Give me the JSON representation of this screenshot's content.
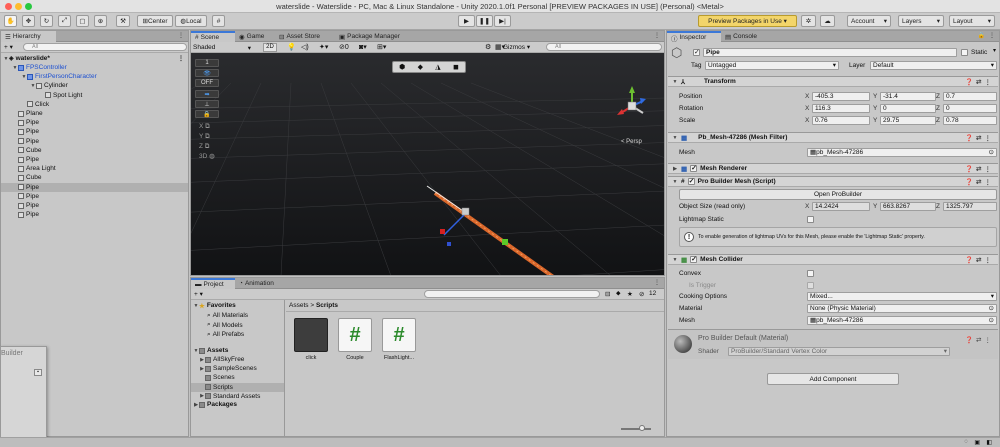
{
  "window": {
    "title": "waterslide - Waterslide - PC, Mac & Linux Standalone - Unity 2020.1.0f1 Personal [PREVIEW PACKAGES IN USE] (Personal) <Metal>"
  },
  "toolbar": {
    "center": "Center",
    "local": "Local",
    "preview_packages": "Preview Packages in Use ▾",
    "account": "Account",
    "layers": "Layers",
    "layout": "Layout"
  },
  "hierarchy": {
    "tab": "Hierarchy",
    "add": "+ ▾",
    "search_placeholder": "All",
    "root": "waterslide*",
    "items": [
      {
        "label": "FPSController",
        "depth": 1,
        "color": "#1b4fd1",
        "expand": "▼"
      },
      {
        "label": "FirstPersonCharacter",
        "depth": 2,
        "color": "#1b4fd1",
        "expand": "▼"
      },
      {
        "label": "Cylinder",
        "depth": 3,
        "color": "#111",
        "expand": "▼"
      },
      {
        "label": "Spot Light",
        "depth": 4,
        "color": "#111",
        "expand": ""
      },
      {
        "label": "Click",
        "depth": 2,
        "color": "#111",
        "expand": ""
      },
      {
        "label": "Plane",
        "depth": 1,
        "color": "#111",
        "expand": ""
      },
      {
        "label": "Pipe",
        "depth": 1,
        "color": "#111",
        "expand": ""
      },
      {
        "label": "Pipe",
        "depth": 1,
        "color": "#111",
        "expand": ""
      },
      {
        "label": "Pipe",
        "depth": 1,
        "color": "#111",
        "expand": ""
      },
      {
        "label": "Cube",
        "depth": 1,
        "color": "#111",
        "expand": ""
      },
      {
        "label": "Pipe",
        "depth": 1,
        "color": "#111",
        "expand": ""
      },
      {
        "label": "Area Light",
        "depth": 1,
        "color": "#111",
        "expand": ""
      },
      {
        "label": "Cube",
        "depth": 1,
        "color": "#111",
        "expand": ""
      },
      {
        "label": "Pipe",
        "depth": 1,
        "color": "#111",
        "expand": ""
      },
      {
        "label": "Pipe",
        "depth": 1,
        "color": "#111",
        "expand": ""
      },
      {
        "label": "Pipe",
        "depth": 1,
        "color": "#111",
        "expand": ""
      },
      {
        "label": "Pipe",
        "depth": 1,
        "color": "#111",
        "expand": ""
      }
    ],
    "selected_index": 13
  },
  "floating_window": {
    "title": "Builder"
  },
  "scene": {
    "tabs": [
      "Scene",
      "Game",
      "Asset Store",
      "Package Manager"
    ],
    "shading": "Shaded",
    "mode_2d": "2D",
    "gizmos": "Gizmos ▾",
    "search_placeholder": "All",
    "persp": "< Persp",
    "axes": [
      "X",
      "Y",
      "Z",
      "3D"
    ],
    "side_labels": [
      "1",
      "OFF"
    ]
  },
  "project": {
    "tabs": [
      "Project",
      "Animation"
    ],
    "favorites_label": "Favorites",
    "favorites": [
      "All Materials",
      "All Models",
      "All Prefabs"
    ],
    "assets_label": "Assets",
    "folders": [
      "AllSkyFree",
      "SampleScenes",
      "Scenes",
      "Scripts",
      "Standard Assets"
    ],
    "selected_folder": "Scripts",
    "packages_label": "Packages",
    "breadcrumb": [
      "Assets",
      "Scripts"
    ],
    "files": [
      {
        "name": "click",
        "type": "dark"
      },
      {
        "name": "Couple",
        "type": "script"
      },
      {
        "name": "FlashLight...",
        "type": "script"
      }
    ],
    "hidden_count": "12"
  },
  "inspector": {
    "tabs": [
      "Inspector",
      "Console"
    ],
    "object_name": "Pipe",
    "static_label": "Static",
    "tag_label": "Tag",
    "tag_value": "Untagged",
    "layer_label": "Layer",
    "layer_value": "Default",
    "transform": {
      "header": "Transform",
      "position_label": "Position",
      "position": {
        "x": "-405.3",
        "y": "-31.4",
        "z": "0.7"
      },
      "rotation_label": "Rotation",
      "rotation": {
        "x": "116.3",
        "y": "0",
        "z": "0"
      },
      "scale_label": "Scale",
      "scale": {
        "x": "0.76",
        "y": "29.75",
        "z": "0.78"
      }
    },
    "mesh_filter": {
      "header": "Pb_Mesh-47286 (Mesh Filter)",
      "mesh_label": "Mesh",
      "mesh_value": "pb_Mesh-47286"
    },
    "mesh_renderer": {
      "header": "Mesh Renderer"
    },
    "probuilder": {
      "header": "Pro Builder Mesh (Script)",
      "open_button": "Open ProBuilder",
      "size_label": "Object Size (read only)",
      "size": {
        "x": "14.2424",
        "y": "663.8267",
        "z": "1325.797"
      },
      "lightmap_label": "Lightmap Static",
      "info": "To enable generation of lightmap UVs for this Mesh, please enable the 'Lightmap Static' property."
    },
    "mesh_collider": {
      "header": "Mesh Collider",
      "convex_label": "Convex",
      "trigger_label": "Is Trigger",
      "cooking_label": "Cooking Options",
      "cooking_value": "Mixed...",
      "material_label": "Material",
      "material_value": "None (Physic Material)",
      "mesh_label": "Mesh",
      "mesh_value": "pb_Mesh-47286"
    },
    "material": {
      "title": "Pro Builder Default (Material)",
      "shader_label": "Shader",
      "shader_value": "ProBuilder/Standard Vertex Color"
    },
    "add_component": "Add Component"
  },
  "colors": {
    "accent_tab": "#3b78d8",
    "pipe": "#d9662a",
    "preview_button": "#f3d56a"
  }
}
